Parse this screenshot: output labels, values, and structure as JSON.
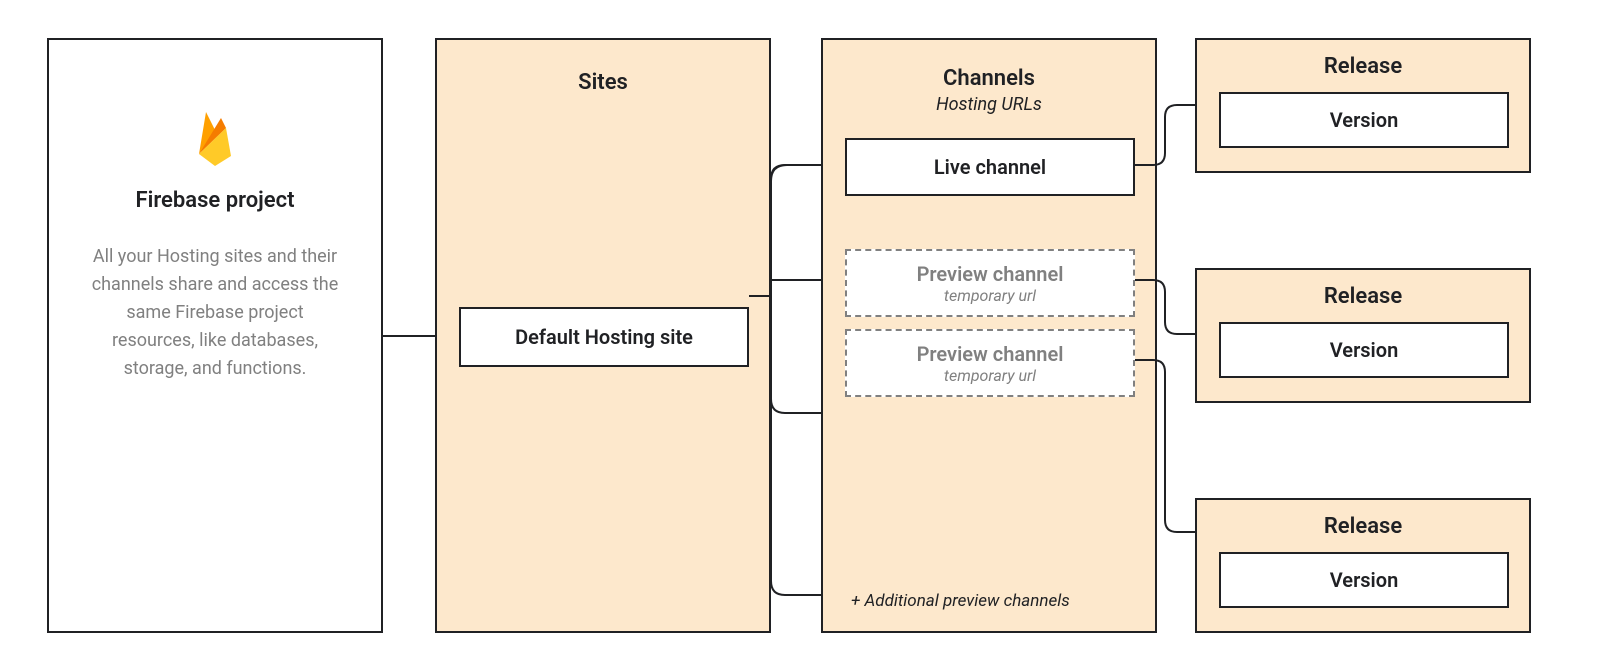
{
  "project": {
    "title": "Firebase project",
    "description": "All your Hosting sites and their channels share and access the same Firebase project resources, like databases, storage, and functions."
  },
  "sites": {
    "title": "Sites",
    "default_site_label": "Default Hosting site"
  },
  "channels": {
    "title": "Channels",
    "subtitle": "Hosting URLs",
    "live_label": "Live channel",
    "preview_label": "Preview channel",
    "preview_sub": "temporary url",
    "note": "+ Additional preview channels"
  },
  "releases": {
    "title": "Release",
    "version_label": "Version"
  }
}
